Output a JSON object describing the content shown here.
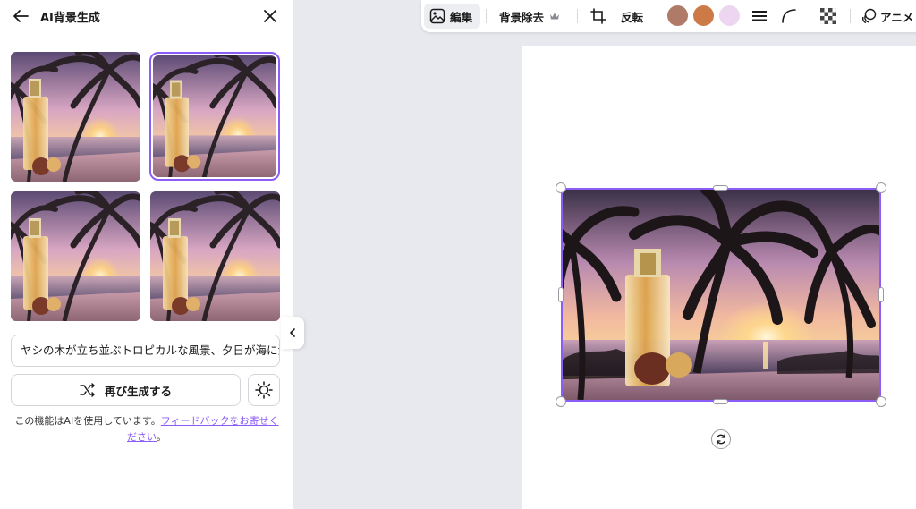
{
  "panel": {
    "title": "AI背景生成",
    "prompt_value": "ヤシの木が立ち並ぶトロピカルな風景、夕日が海に沈む",
    "regenerate_label": "再び生成する",
    "disclaimer_text": "この機能はAIを使用しています。",
    "feedback_link": "フィードバックをお寄せください",
    "disclaimer_end": "。",
    "thumbnails": [
      {
        "selected": false
      },
      {
        "selected": true
      },
      {
        "selected": false
      },
      {
        "selected": false
      }
    ]
  },
  "toolbar": {
    "edit_label": "編集",
    "remove_bg_label": "背景除去",
    "flip_label": "反転",
    "animate_label": "アニメ",
    "swatches": [
      "#b07a68",
      "#cc7a47",
      "#ecd6f0"
    ],
    "icons": [
      "edit-image-icon",
      "crown-icon",
      "crop-icon",
      "line-weight-icon",
      "corner-rounding-icon",
      "transparency-icon",
      "animate-icon"
    ]
  },
  "colors": {
    "accent": "#8b5cf6",
    "panel_bg": "#ffffff",
    "workspace_bg": "#e8e9ee"
  }
}
